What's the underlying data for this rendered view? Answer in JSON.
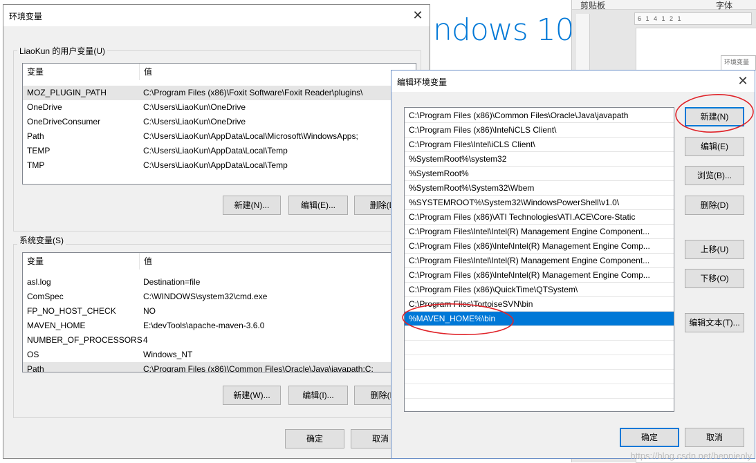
{
  "background": {
    "windows_logo": "ndows 10",
    "ribbon": {
      "clipboard": "剪贴板",
      "font": "字体"
    },
    "ruler_text": "6 1 4 1 2 1",
    "thumb_title": "环境变量"
  },
  "env_dialog": {
    "title": "环境变量",
    "user_group_label": "LiaoKun 的用户变量(U)",
    "system_group_label": "系统变量(S)",
    "col_var": "变量",
    "col_val": "值",
    "user_vars": [
      {
        "name": "MOZ_PLUGIN_PATH",
        "value": "C:\\Program Files (x86)\\Foxit Software\\Foxit Reader\\plugins\\"
      },
      {
        "name": "OneDrive",
        "value": "C:\\Users\\LiaoKun\\OneDrive"
      },
      {
        "name": "OneDriveConsumer",
        "value": "C:\\Users\\LiaoKun\\OneDrive"
      },
      {
        "name": "Path",
        "value": "C:\\Users\\LiaoKun\\AppData\\Local\\Microsoft\\WindowsApps;"
      },
      {
        "name": "TEMP",
        "value": "C:\\Users\\LiaoKun\\AppData\\Local\\Temp"
      },
      {
        "name": "TMP",
        "value": "C:\\Users\\LiaoKun\\AppData\\Local\\Temp"
      }
    ],
    "system_vars": [
      {
        "name": "asl.log",
        "value": "Destination=file"
      },
      {
        "name": "ComSpec",
        "value": "C:\\WINDOWS\\system32\\cmd.exe"
      },
      {
        "name": "FP_NO_HOST_CHECK",
        "value": "NO"
      },
      {
        "name": "MAVEN_HOME",
        "value": "E:\\devTools\\apache-maven-3.6.0"
      },
      {
        "name": "NUMBER_OF_PROCESSORS",
        "value": "4"
      },
      {
        "name": "OS",
        "value": "Windows_NT"
      },
      {
        "name": "Path",
        "value": "C:\\Program Files (x86)\\Common Files\\Oracle\\Java\\javapath;C:"
      }
    ],
    "user_buttons": {
      "new": "新建(N)...",
      "edit": "编辑(E)...",
      "delete": "删除(D)"
    },
    "system_buttons": {
      "new": "新建(W)...",
      "edit": "编辑(I)...",
      "delete": "删除(L)"
    },
    "ok": "确定",
    "cancel": "取消"
  },
  "edit_dialog": {
    "title": "编辑环境变量",
    "paths": [
      "C:\\Program Files (x86)\\Common Files\\Oracle\\Java\\javapath",
      "C:\\Program Files (x86)\\Intel\\iCLS Client\\",
      "C:\\Program Files\\Intel\\iCLS Client\\",
      "%SystemRoot%\\system32",
      "%SystemRoot%",
      "%SystemRoot%\\System32\\Wbem",
      "%SYSTEMROOT%\\System32\\WindowsPowerShell\\v1.0\\",
      "C:\\Program Files (x86)\\ATI Technologies\\ATI.ACE\\Core-Static",
      "C:\\Program Files\\Intel\\Intel(R) Management Engine Component...",
      "C:\\Program Files (x86)\\Intel\\Intel(R) Management Engine Comp...",
      "C:\\Program Files\\Intel\\Intel(R) Management Engine Component...",
      "C:\\Program Files (x86)\\Intel\\Intel(R) Management Engine Comp...",
      "C:\\Program Files (x86)\\QuickTime\\QTSystem\\",
      "C:\\Program Files\\TortoiseSVN\\bin",
      "%MAVEN_HOME%\\bin"
    ],
    "selected_index": 14,
    "buttons": {
      "new": "新建(N)",
      "edit": "编辑(E)",
      "browse": "浏览(B)...",
      "delete": "删除(D)",
      "move_up": "上移(U)",
      "move_down": "下移(O)",
      "edit_text": "编辑文本(T)..."
    },
    "ok": "确定",
    "cancel": "取消"
  },
  "watermark": "https://blog.csdn.net/bennieoly",
  "colors": {
    "selection": "#0078d7",
    "annotation": "#e0242a"
  }
}
